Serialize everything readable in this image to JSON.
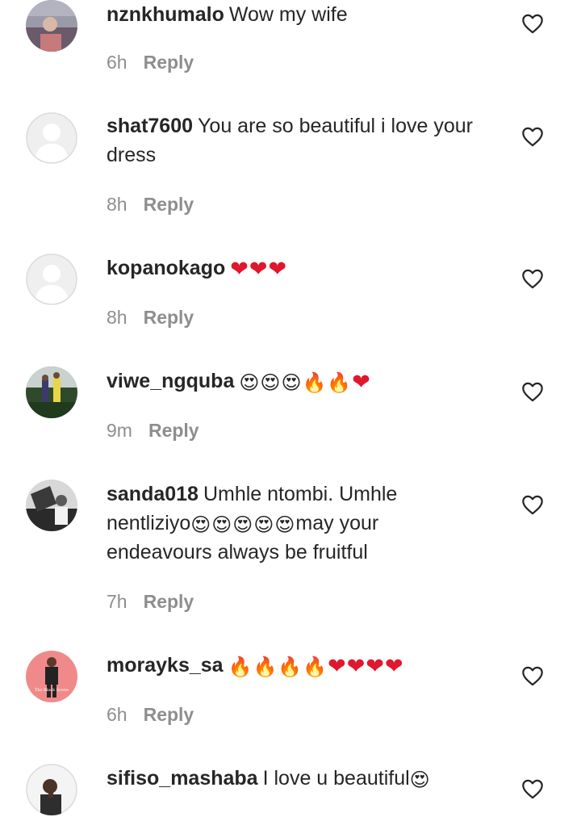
{
  "colors": {
    "text": "#262626",
    "muted": "#8e8e8e",
    "heart_emoji": "#e0182d",
    "placeholder_avatar": "#dbdbdb"
  },
  "comments": [
    {
      "username": "nznkhumalo",
      "text": "Wow my wife",
      "emojis": [],
      "time": "6h",
      "reply_label": "Reply",
      "avatar": "photo-avatar"
    },
    {
      "username": "shat7600",
      "text": "You are so beautiful i love your dress",
      "emojis": [],
      "time": "8h",
      "reply_label": "Reply",
      "avatar": "default-avatar"
    },
    {
      "username": "kopanokago",
      "text": "",
      "emojis": [
        "❤",
        "❤",
        "❤"
      ],
      "time": "8h",
      "reply_label": "Reply",
      "avatar": "default-avatar"
    },
    {
      "username": "viwe_ngquba",
      "text": "",
      "emojis": [
        "😍",
        "😍",
        "😍",
        "🔥",
        "🔥",
        "❤"
      ],
      "time": "9m",
      "reply_label": "Reply",
      "avatar": "photo-avatar"
    },
    {
      "username": "sanda018",
      "text_before": "Umhle ntombi. Umhle nentliziyo",
      "emojis": [
        "😍",
        "😍",
        "😍",
        "😍",
        "😍"
      ],
      "text_after": "may your endeavours always be fruitful",
      "time": "7h",
      "reply_label": "Reply",
      "avatar": "photo-avatar"
    },
    {
      "username": "morayks_sa",
      "text": "",
      "emojis": [
        "🔥",
        "🔥",
        "🔥",
        "🔥",
        "❤",
        "❤",
        "❤",
        "❤"
      ],
      "time": "6h",
      "reply_label": "Reply",
      "avatar": "photo-avatar",
      "avatar_caption": "The Black Scene"
    },
    {
      "username": "sifiso_mashaba",
      "text": "I love u beautiful",
      "emojis": [
        "😍"
      ],
      "time": "",
      "reply_label": "",
      "avatar": "photo-avatar"
    }
  ]
}
